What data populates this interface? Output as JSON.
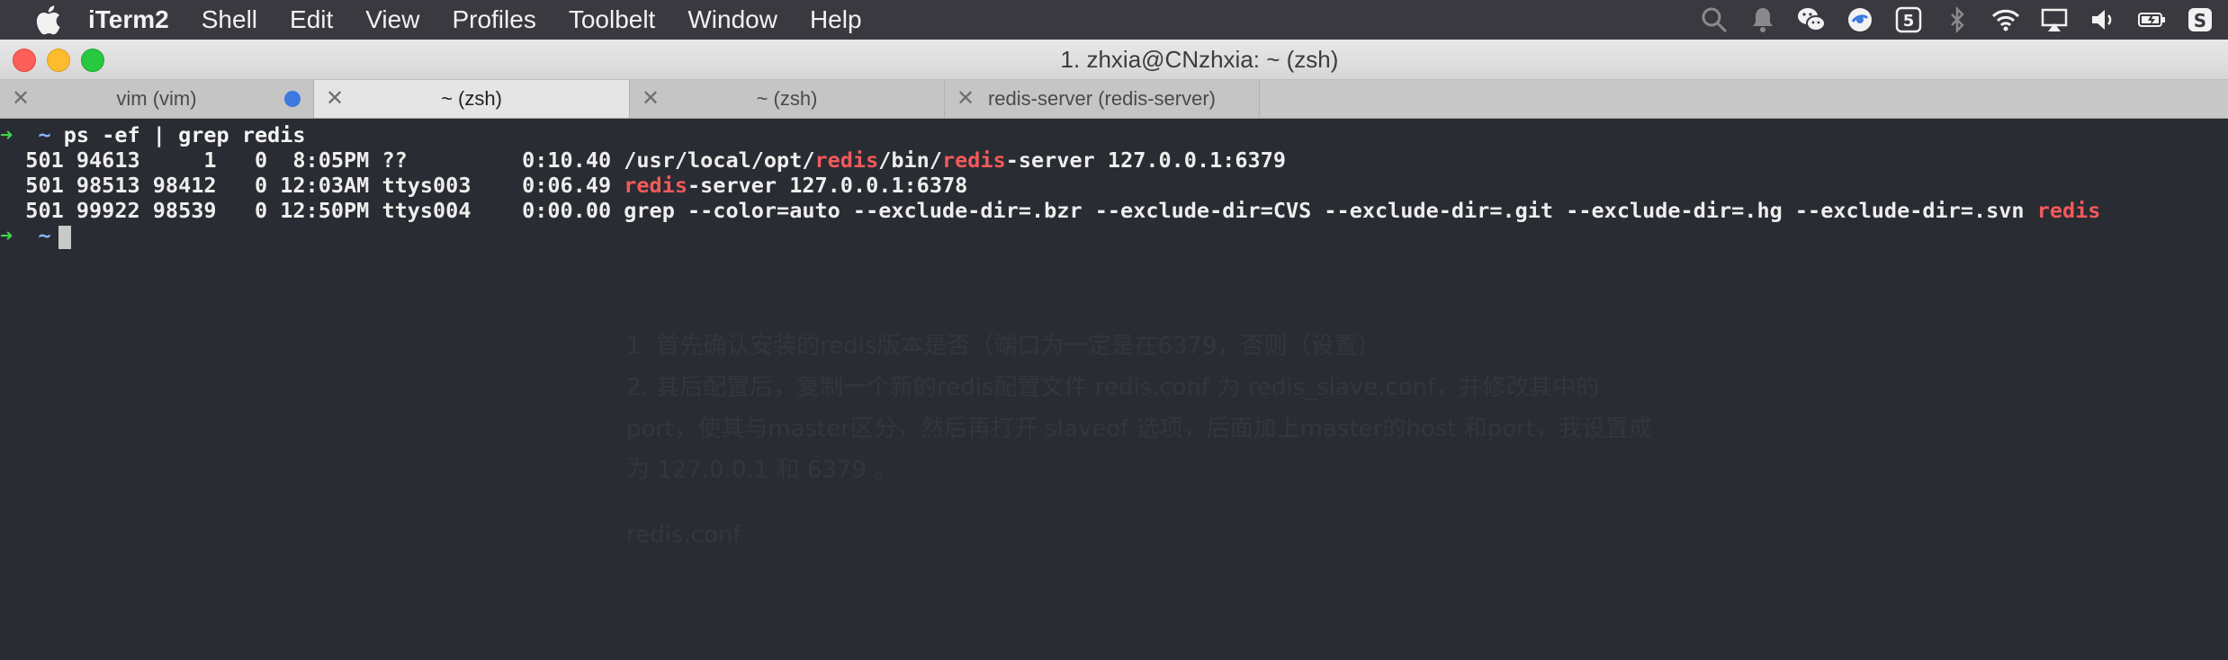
{
  "menubar": {
    "app_name": "iTerm2",
    "items": [
      "Shell",
      "Edit",
      "View",
      "Profiles",
      "Toolbelt",
      "Window",
      "Help"
    ],
    "status_icons": [
      "search-icon",
      "notification-icon",
      "wechat-icon",
      "browser-icon",
      "s-app-icon",
      "bluetooth-icon",
      "wifi-icon",
      "airplay-icon",
      "volume-icon",
      "battery-icon",
      "s-app-2-icon"
    ]
  },
  "window": {
    "title": "1. zhxia@CNzhxia: ~ (zsh)"
  },
  "tabs": [
    {
      "label": "vim (vim)",
      "active": false,
      "has_activity": true
    },
    {
      "label": "~ (zsh)",
      "active": true,
      "has_activity": false
    },
    {
      "label": "~ (zsh)",
      "active": false,
      "has_activity": false
    },
    {
      "label": "redis-server (redis-server)",
      "active": false,
      "has_activity": false
    }
  ],
  "terminal": {
    "prompt_arrow": "➜",
    "prompt_dir": "~",
    "command": "ps -ef | grep redis",
    "rows": [
      {
        "pre": "  501 94613     1   0  8:05PM ??         0:10.40 /usr/local/opt/",
        "m1": "redis",
        "mid": "/bin/",
        "m2": "redis",
        "post": "-server 127.0.0.1:6379"
      },
      {
        "pre": "  501 98513 98412   0 12:03AM ttys003    0:06.49 ",
        "m1": "redis",
        "mid": "-server 127.0.0.1:6378",
        "m2": "",
        "post": ""
      },
      {
        "pre": "  501 99922 98539   0 12:50PM ttys004    0:00.00 grep --color=auto --exclude-dir=.bzr --exclude-dir=CVS --exclude-dir=.git --exclude-dir=.hg --exclude-dir=.svn ",
        "m1": "redis",
        "mid": "",
        "m2": "",
        "post": ""
      }
    ],
    "background_ghost": [
      "1. 首先确认安装的redis版本是否（端口为一定是在6379，否则（设置）",
      "2. 其后配置后，复制一个新的redis配置文件 redis.conf 为 redis_slave.conf，并修改其中的",
      "port，使其与master区分，然后再打开 slaveof 选项，后面加上master的host 和port，我设置成",
      "为 127.0.0.1 和 6379 。",
      "redis.conf"
    ]
  }
}
